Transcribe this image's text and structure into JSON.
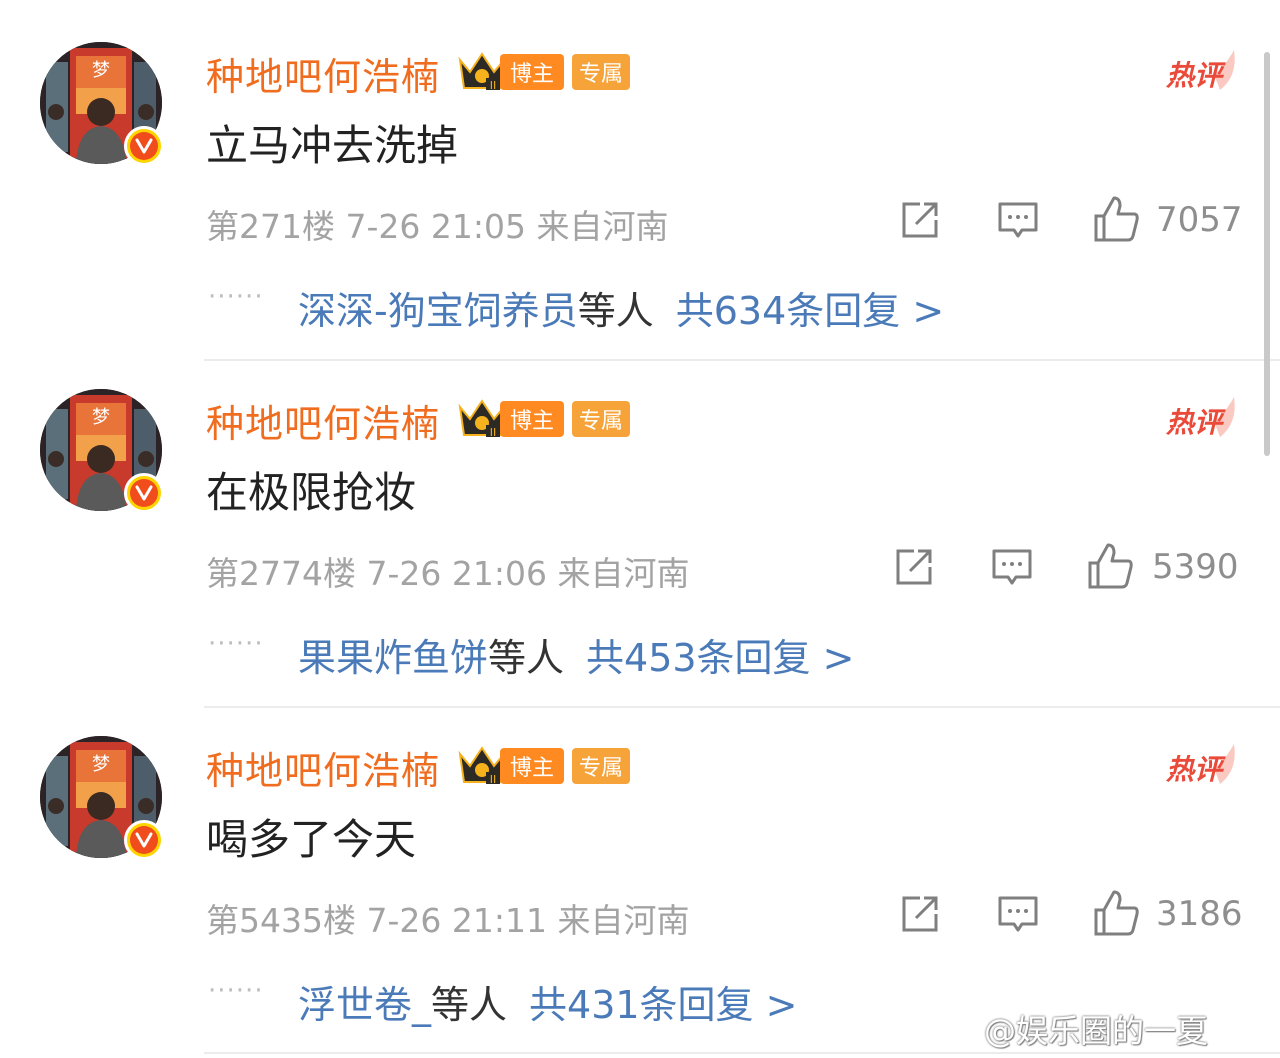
{
  "comments": [
    {
      "username": "种地吧何浩楠",
      "badge_blogger": "博主",
      "badge_exclusive": "专属",
      "hot_label": "热评",
      "content": "立马冲去洗掉",
      "meta": "第271楼 7-26 21:05 来自河南",
      "likes": "7057",
      "reply_dots": "······",
      "reply_user": "深深-狗宝饲养员",
      "reply_etc": "等人",
      "reply_total": "共634条回复 >"
    },
    {
      "username": "种地吧何浩楠",
      "badge_blogger": "博主",
      "badge_exclusive": "专属",
      "hot_label": "热评",
      "content": "在极限抢妆",
      "meta": "第2774楼 7-26 21:06 来自河南",
      "likes": "5390",
      "reply_dots": "······",
      "reply_user": "果果炸鱼饼",
      "reply_etc": "等人",
      "reply_total": "共453条回复 >"
    },
    {
      "username": "种地吧何浩楠",
      "badge_blogger": "博主",
      "badge_exclusive": "专属",
      "hot_label": "热评",
      "content": "喝多了今天",
      "meta": "第5435楼 7-26 21:11 来自河南",
      "likes": "3186",
      "reply_dots": "······",
      "reply_user": "浮世卷_",
      "reply_etc": "等人",
      "reply_total": "共431条回复 >"
    }
  ],
  "watermark": "@娱乐圈的一夏",
  "colors": {
    "username": "#f06c1e",
    "reply_link": "#4a7ab8",
    "meta": "#a3a3a3",
    "hot": "#ea4a3a"
  }
}
